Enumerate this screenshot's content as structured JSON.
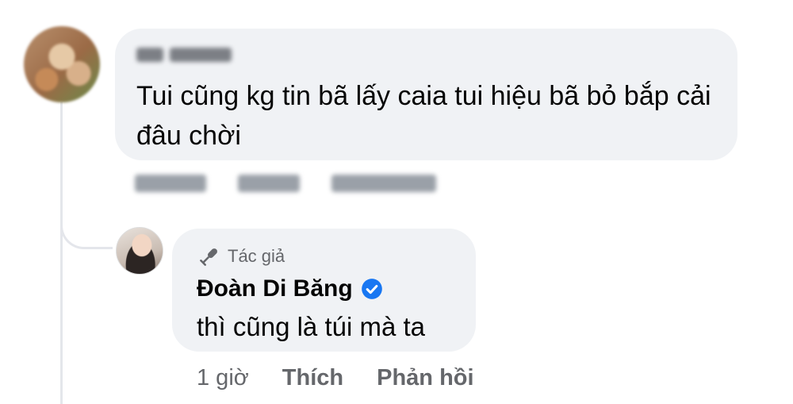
{
  "comment1": {
    "text": "Tui cũng kg tin bã lấy caia tui hiệu bã bỏ bắp cải đâu chời"
  },
  "reply": {
    "author_badge": "Tác giả",
    "author_name": "Đoàn Di Băng",
    "text": "thì cũng là túi mà ta",
    "time": "1 giờ",
    "like_label": "Thích",
    "reply_label": "Phản hồi"
  },
  "icons": {
    "author_badge_icon": "microphone-icon",
    "verified_icon": "verified-badge-icon"
  },
  "colors": {
    "bubble_bg": "#f0f2f5",
    "secondary_text": "#65676b",
    "verified_blue": "#1877f2"
  }
}
